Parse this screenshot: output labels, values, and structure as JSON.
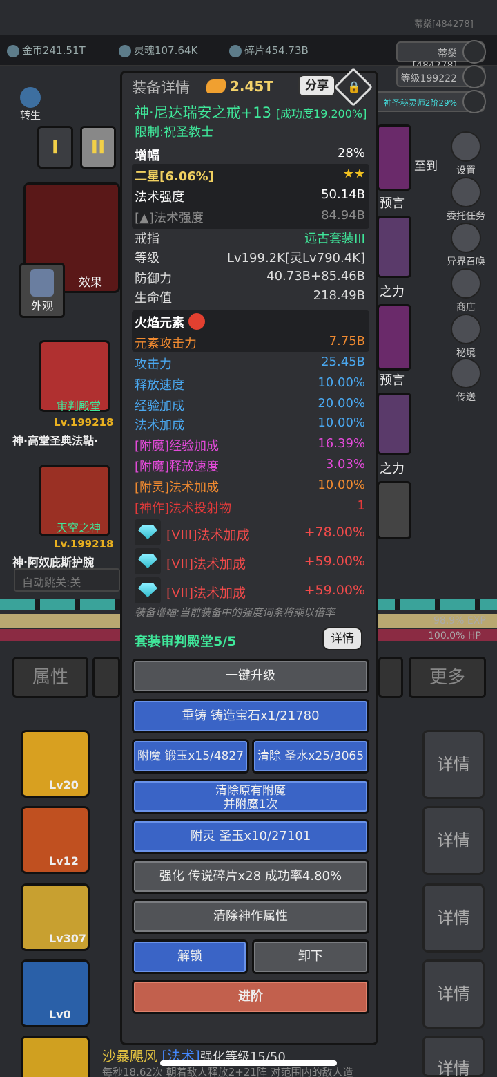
{
  "topbar": {
    "gold": "金币241.51T",
    "soul": "灵魂107.64K",
    "shard": "碎片454.73B",
    "player_name": "蒂燊[484278]",
    "player_name_top": "蒂燊[484278]",
    "level": "等级199222",
    "title": "神圣秘灵师2阶29%"
  },
  "left": {
    "rebirth": "转生",
    "tab1": "I",
    "tab2": "II",
    "effect": "效果",
    "appearance": "外观",
    "item1_set": "审判殿堂",
    "item1_level": "Lv.199218",
    "item1_name": "神·高堂圣典法䩞·",
    "item2_set": "天空之神",
    "item2_level": "Lv.199218",
    "item2_name": "神·阿奴庇斯护腕",
    "autojump": "自动跳关:关"
  },
  "right_menu": [
    "设置",
    "委托任务",
    "异界召唤",
    "商店",
    "秘境",
    "传送"
  ],
  "right_partials": [
    "预言",
    "之力",
    "预言",
    "之力"
  ],
  "right_partial_top": "至到",
  "status": {
    "exp": "98.9% EXP",
    "hp": "100.0% HP"
  },
  "bottom_tabs": {
    "attr": "属性",
    "more": "更多"
  },
  "skills": [
    {
      "level": "Lv20",
      "detail": "详情"
    },
    {
      "level": "Lv12",
      "detail": "详情"
    },
    {
      "level": "Lv307",
      "detail": "详情"
    },
    {
      "level": "Lv0",
      "detail": "详情"
    }
  ],
  "skill_name": "沙暴飓风",
  "skill_tag": "[法术]",
  "skill_strength": "强化等级15/50",
  "skill_desc": "每秒18.62次 朝着敌人释放2+21阵 对范围内的敌人造",
  "last_detail": "详情",
  "modal": {
    "header": "装备详情",
    "power": "2.45T",
    "share": "分享",
    "item_name": "神·尼达瑞安之戒+13",
    "success": "[成功度19.200%]",
    "restriction": "限制:祝圣教士",
    "amp_label": "增幅",
    "amp_value": "28%",
    "star_label": "二星[6.06%]",
    "stars": "★★",
    "spell_label": "法术强度",
    "spell_value": "50.14B",
    "next_spell_label": "[▲]法术强度",
    "next_spell_value": "84.94B",
    "type_label": "戒指",
    "type_value": "远古套装III",
    "lvl_label": "等级",
    "lvl_value": "Lv199.2K[灵Lv790.4K]",
    "def_label": "防御力",
    "def_value": "40.73B+85.46B",
    "hp_label": "生命值",
    "hp_value": "218.49B",
    "element_label": "火焰元素",
    "elem_atk_label": "元素攻击力",
    "elem_atk_value": "7.75B",
    "stats": [
      {
        "k": "攻击力",
        "v": "25.45B"
      },
      {
        "k": "释放速度",
        "v": "10.00%"
      },
      {
        "k": "经验加成",
        "v": "20.00%"
      },
      {
        "k": "法术加成",
        "v": "10.00%"
      }
    ],
    "enchants": [
      {
        "k": "[附魔]经验加成",
        "v": "16.39%"
      },
      {
        "k": "[附魔]释放速度",
        "v": "3.03%"
      }
    ],
    "spirit": {
      "k": "[附灵]法术加成",
      "v": "10.00%"
    },
    "divine": {
      "k": "[神作]法术投射物",
      "v": "1"
    },
    "gems": [
      {
        "k": "[VIII]法术加成",
        "v": "+78.00%"
      },
      {
        "k": "[VII]法术加成",
        "v": "+59.00%"
      },
      {
        "k": "[VII]法术加成",
        "v": "+59.00%"
      }
    ],
    "note": "装备增幅:当前装备中的强度词条将乘以倍率",
    "set_label": "套装审判殿堂5/5",
    "set_detail": "详情",
    "btn_upgrade": "一键升级",
    "btn_recast": "重铸 铸造宝石x1/21780",
    "btn_enchant": "附魔 锻玉x15/4827",
    "btn_clear": "清除 圣水x25/3065",
    "btn_reenchant1": "清除原有附魔",
    "btn_reenchant2": "并附魔1次",
    "btn_spirit": "附灵 圣玉x10/27101",
    "btn_strengthen": "强化 传说碎片x28 成功率4.80%",
    "btn_clear_divine": "清除神作属性",
    "btn_unlock": "解锁",
    "btn_unequip": "卸下",
    "btn_advance": "进阶"
  }
}
